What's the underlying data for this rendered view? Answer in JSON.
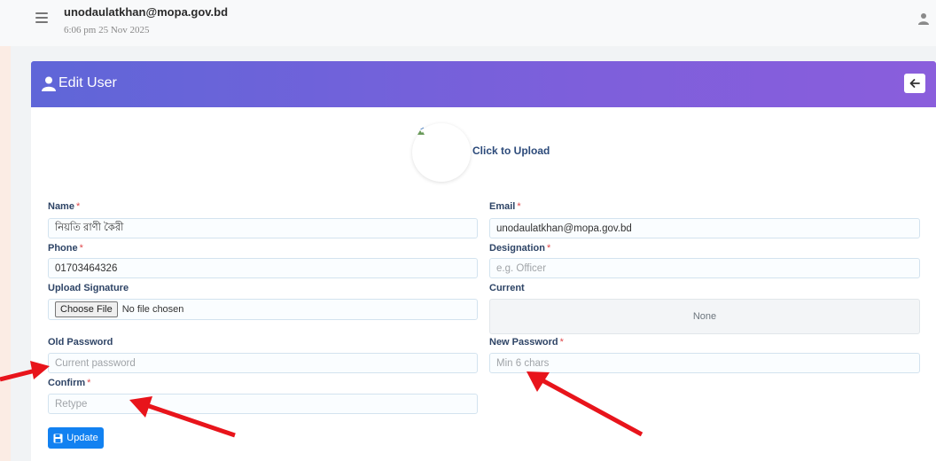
{
  "topbar": {
    "email": "unodaulatkhan@mopa.gov.bd",
    "datetime": "6:06 pm 25 Nov 2025",
    "menu_icon": "hamburger-icon",
    "user_icon": "user-icon"
  },
  "card": {
    "title": "Edit User",
    "title_icon": "user-icon",
    "back_icon": "arrow-left-icon"
  },
  "upload": {
    "label": "Click to Upload",
    "image_icon": "broken-image-icon"
  },
  "form": {
    "required_mark": "*",
    "name": {
      "label": "Name",
      "value": "নিয়তি রাণী কৈরী"
    },
    "email": {
      "label": "Email",
      "value": "unodaulatkhan@mopa.gov.bd"
    },
    "phone": {
      "label": "Phone",
      "value": "01703464326"
    },
    "designation": {
      "label": "Designation",
      "placeholder": "e.g. Officer"
    },
    "signature": {
      "label": "Upload Signature",
      "button": "Choose File",
      "status": "No file chosen"
    },
    "current": {
      "label": "Current",
      "value": "None"
    },
    "old_password": {
      "label": "Old Password",
      "placeholder": "Current password"
    },
    "new_password": {
      "label": "New Password",
      "placeholder": "Min 6 chars"
    },
    "confirm": {
      "label": "Confirm",
      "placeholder": "Retype"
    },
    "submit": {
      "label": "Update",
      "icon": "save-icon"
    }
  },
  "colors": {
    "header_gradient_start": "#5f66d8",
    "header_gradient_end": "#8a5edc",
    "primary_button": "#1281f1",
    "required": "#e0484b",
    "annotation_arrow": "#e8141b"
  }
}
